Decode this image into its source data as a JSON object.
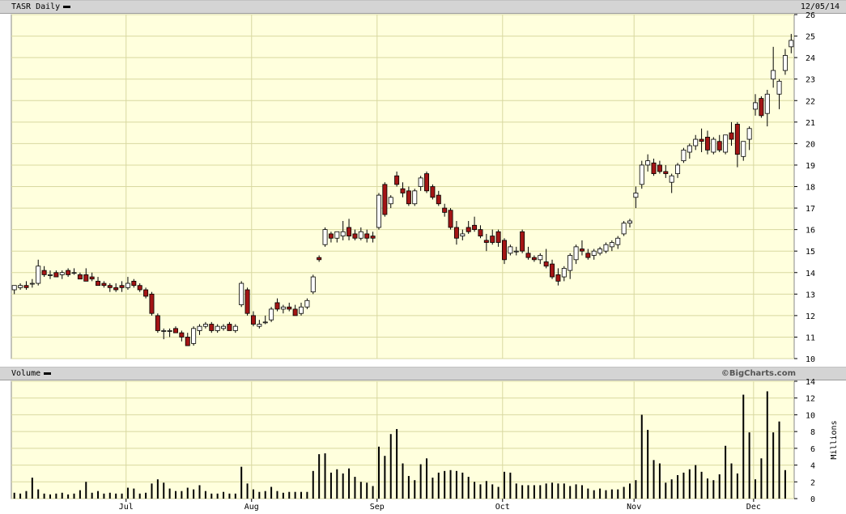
{
  "price_header": {
    "label": "TASR Daily",
    "date": "12/05/14"
  },
  "volume_header": {
    "label": "Volume",
    "brand": "©BigCharts.com"
  },
  "colors": {
    "background": "#ffffdd",
    "grid": "#d8d8a0",
    "up": "#ffffff",
    "down": "#a31515",
    "outline": "#000000"
  },
  "chart_data": [
    {
      "type": "candlestick",
      "title": "TASR Daily",
      "ylim": [
        10,
        26
      ],
      "yticks": [
        10,
        11,
        12,
        13,
        14,
        15,
        16,
        17,
        18,
        19,
        20,
        21,
        22,
        23,
        24,
        25,
        26
      ],
      "x_tick_labels": [
        "Jul",
        "Aug",
        "Sep",
        "Oct",
        "Nov",
        "Dec"
      ],
      "month_start_index": [
        19,
        40,
        61,
        82,
        104,
        124
      ],
      "grid": true,
      "ohlc": [
        [
          13.2,
          13.4,
          13.0,
          13.4
        ],
        [
          13.3,
          13.5,
          13.2,
          13.4
        ],
        [
          13.4,
          13.6,
          13.2,
          13.3
        ],
        [
          13.5,
          13.7,
          13.3,
          13.5
        ],
        [
          13.5,
          14.6,
          13.4,
          14.3
        ],
        [
          14.1,
          14.3,
          13.8,
          13.9
        ],
        [
          13.9,
          14.1,
          13.7,
          13.9
        ],
        [
          14.0,
          14.1,
          13.8,
          13.8
        ],
        [
          13.9,
          14.1,
          13.7,
          14.0
        ],
        [
          14.1,
          14.2,
          13.8,
          13.9
        ],
        [
          14.0,
          14.2,
          13.9,
          14.0
        ],
        [
          13.9,
          14.0,
          13.7,
          13.7
        ],
        [
          13.9,
          14.2,
          13.6,
          13.6
        ],
        [
          13.8,
          14.0,
          13.6,
          13.7
        ],
        [
          13.6,
          13.8,
          13.4,
          13.4
        ],
        [
          13.5,
          13.6,
          13.3,
          13.4
        ],
        [
          13.4,
          13.5,
          13.1,
          13.3
        ],
        [
          13.3,
          13.5,
          13.1,
          13.2
        ],
        [
          13.4,
          13.6,
          13.1,
          13.3
        ],
        [
          13.3,
          13.8,
          13.2,
          13.5
        ],
        [
          13.6,
          13.7,
          13.3,
          13.4
        ],
        [
          13.4,
          13.5,
          13.1,
          13.2
        ],
        [
          13.2,
          13.3,
          12.8,
          12.9
        ],
        [
          13.0,
          13.1,
          12.0,
          12.1
        ],
        [
          12.0,
          12.1,
          11.2,
          11.3
        ],
        [
          11.3,
          11.4,
          10.9,
          11.3
        ],
        [
          11.3,
          11.4,
          11.0,
          11.3
        ],
        [
          11.4,
          11.5,
          11.2,
          11.2
        ],
        [
          11.2,
          11.3,
          10.8,
          11.0
        ],
        [
          11.0,
          11.2,
          10.6,
          10.6
        ],
        [
          10.7,
          11.5,
          10.6,
          11.4
        ],
        [
          11.3,
          11.6,
          11.1,
          11.5
        ],
        [
          11.5,
          11.7,
          11.4,
          11.6
        ],
        [
          11.6,
          11.7,
          11.2,
          11.3
        ],
        [
          11.3,
          11.6,
          11.2,
          11.5
        ],
        [
          11.4,
          11.6,
          11.3,
          11.5
        ],
        [
          11.6,
          11.7,
          11.3,
          11.3
        ],
        [
          11.3,
          11.6,
          11.2,
          11.5
        ],
        [
          12.5,
          13.6,
          12.4,
          13.5
        ],
        [
          13.2,
          13.3,
          12.0,
          12.1
        ],
        [
          12.0,
          12.2,
          11.5,
          11.6
        ],
        [
          11.5,
          11.8,
          11.4,
          11.6
        ],
        [
          11.7,
          12.0,
          11.6,
          11.7
        ],
        [
          11.8,
          12.4,
          11.7,
          12.3
        ],
        [
          12.6,
          12.8,
          12.2,
          12.3
        ],
        [
          12.3,
          12.5,
          12.1,
          12.4
        ],
        [
          12.4,
          12.6,
          12.2,
          12.3
        ],
        [
          12.3,
          12.5,
          12.0,
          12.0
        ],
        [
          12.1,
          12.6,
          12.0,
          12.4
        ],
        [
          12.4,
          12.8,
          12.3,
          12.7
        ],
        [
          13.1,
          13.9,
          13.0,
          13.8
        ],
        [
          14.7,
          14.8,
          14.5,
          14.6
        ],
        [
          15.3,
          16.1,
          15.2,
          16.0
        ],
        [
          15.8,
          15.9,
          15.4,
          15.6
        ],
        [
          15.6,
          15.9,
          15.4,
          15.9
        ],
        [
          15.7,
          16.4,
          15.5,
          15.9
        ],
        [
          16.1,
          16.5,
          15.5,
          15.7
        ],
        [
          15.8,
          16.0,
          15.5,
          15.6
        ],
        [
          15.6,
          16.1,
          15.5,
          15.9
        ],
        [
          15.8,
          16.0,
          15.4,
          15.6
        ],
        [
          15.7,
          15.9,
          15.4,
          15.6
        ],
        [
          16.1,
          17.7,
          16.0,
          17.6
        ],
        [
          18.1,
          18.2,
          16.6,
          16.7
        ],
        [
          17.2,
          17.6,
          17.0,
          17.5
        ],
        [
          18.5,
          18.7,
          18.0,
          18.1
        ],
        [
          17.9,
          18.2,
          17.5,
          17.7
        ],
        [
          17.8,
          18.0,
          17.1,
          17.2
        ],
        [
          17.2,
          17.9,
          17.1,
          17.8
        ],
        [
          18.0,
          18.5,
          17.8,
          18.4
        ],
        [
          18.6,
          18.7,
          17.7,
          17.8
        ],
        [
          18.0,
          18.1,
          17.4,
          17.5
        ],
        [
          17.6,
          17.8,
          17.1,
          17.2
        ],
        [
          17.0,
          17.2,
          16.6,
          16.8
        ],
        [
          16.9,
          17.0,
          16.0,
          16.1
        ],
        [
          16.1,
          16.4,
          15.3,
          15.6
        ],
        [
          15.7,
          16.0,
          15.5,
          15.8
        ],
        [
          16.1,
          16.4,
          15.8,
          15.9
        ],
        [
          16.2,
          16.6,
          15.9,
          16.0
        ],
        [
          16.0,
          16.2,
          15.6,
          15.7
        ],
        [
          15.5,
          15.8,
          15.0,
          15.4
        ],
        [
          15.7,
          16.0,
          15.3,
          15.4
        ],
        [
          15.9,
          16.0,
          15.2,
          15.4
        ],
        [
          15.5,
          15.6,
          14.4,
          14.6
        ],
        [
          14.9,
          15.3,
          14.8,
          15.2
        ],
        [
          15.0,
          15.2,
          14.8,
          15.0
        ],
        [
          15.9,
          16.0,
          14.9,
          15.0
        ],
        [
          14.9,
          15.2,
          14.6,
          14.7
        ],
        [
          14.7,
          14.8,
          14.5,
          14.6
        ],
        [
          14.6,
          14.9,
          14.4,
          14.8
        ],
        [
          14.5,
          15.1,
          14.2,
          14.3
        ],
        [
          14.4,
          14.6,
          13.7,
          13.8
        ],
        [
          13.9,
          14.2,
          13.4,
          13.6
        ],
        [
          13.8,
          14.3,
          13.6,
          14.2
        ],
        [
          14.1,
          14.9,
          13.7,
          14.8
        ],
        [
          14.6,
          15.3,
          14.4,
          15.2
        ],
        [
          15.1,
          15.5,
          14.8,
          15.0
        ],
        [
          14.9,
          15.1,
          14.6,
          14.7
        ],
        [
          14.8,
          15.1,
          14.6,
          15.0
        ],
        [
          14.9,
          15.2,
          14.8,
          15.1
        ],
        [
          15.0,
          15.4,
          14.9,
          15.3
        ],
        [
          15.2,
          15.5,
          15.0,
          15.4
        ],
        [
          15.3,
          15.7,
          15.1,
          15.6
        ],
        [
          15.8,
          16.4,
          15.7,
          16.3
        ],
        [
          16.3,
          16.5,
          16.1,
          16.4
        ],
        [
          17.5,
          18.0,
          17.0,
          17.7
        ],
        [
          18.1,
          19.2,
          17.9,
          19.0
        ],
        [
          19.0,
          19.5,
          18.7,
          19.2
        ],
        [
          19.1,
          19.3,
          18.5,
          18.6
        ],
        [
          19.0,
          19.2,
          18.6,
          18.7
        ],
        [
          18.7,
          19.0,
          18.4,
          18.6
        ],
        [
          18.2,
          18.6,
          17.7,
          18.5
        ],
        [
          18.6,
          19.1,
          18.4,
          19.0
        ],
        [
          19.2,
          19.8,
          19.1,
          19.7
        ],
        [
          19.6,
          20.0,
          19.3,
          19.9
        ],
        [
          19.9,
          20.4,
          19.7,
          20.2
        ],
        [
          20.2,
          20.7,
          19.6,
          20.1
        ],
        [
          20.3,
          20.6,
          19.5,
          19.7
        ],
        [
          19.6,
          20.3,
          19.5,
          20.2
        ],
        [
          20.1,
          20.4,
          19.6,
          19.7
        ],
        [
          19.6,
          20.3,
          19.5,
          20.4
        ],
        [
          20.5,
          21.0,
          19.9,
          20.2
        ],
        [
          20.9,
          21.0,
          18.9,
          19.5
        ],
        [
          19.4,
          20.1,
          19.2,
          20.1
        ],
        [
          20.2,
          20.8,
          19.7,
          20.7
        ],
        [
          21.6,
          22.3,
          21.3,
          21.9
        ],
        [
          22.1,
          22.2,
          21.2,
          21.3
        ],
        [
          21.4,
          22.5,
          20.8,
          22.3
        ],
        [
          23.0,
          24.5,
          22.6,
          23.4
        ],
        [
          22.3,
          23.0,
          21.6,
          22.9
        ],
        [
          23.4,
          24.4,
          23.2,
          24.1
        ],
        [
          24.5,
          25.1,
          24.2,
          24.8
        ]
      ]
    },
    {
      "type": "bar",
      "title": "Volume",
      "ylabel": "Millions",
      "ylim": [
        0,
        14
      ],
      "yticks": [
        0,
        2,
        4,
        6,
        8,
        10,
        12,
        14
      ],
      "grid": true,
      "values": [
        0.7,
        0.6,
        0.9,
        2.5,
        1.1,
        0.6,
        0.5,
        0.6,
        0.7,
        0.5,
        0.6,
        1.0,
        2.0,
        0.7,
        0.9,
        0.6,
        0.7,
        0.6,
        0.6,
        1.3,
        1.2,
        0.6,
        0.7,
        1.8,
        2.3,
        1.9,
        1.2,
        0.9,
        0.9,
        1.3,
        1.1,
        1.6,
        0.9,
        0.6,
        0.6,
        0.8,
        0.6,
        0.6,
        3.8,
        1.8,
        1.1,
        0.8,
        0.9,
        1.4,
        0.9,
        0.7,
        0.8,
        0.8,
        0.8,
        0.8,
        3.3,
        5.3,
        5.4,
        3.1,
        3.5,
        3.0,
        3.6,
        2.6,
        2.0,
        1.9,
        1.5,
        6.2,
        5.1,
        7.7,
        8.3,
        4.2,
        2.7,
        2.2,
        4.1,
        4.8,
        2.5,
        3.1,
        3.3,
        3.4,
        3.3,
        3.1,
        2.6,
        2.0,
        1.7,
        2.1,
        1.7,
        1.4,
        3.2,
        3.1,
        1.8,
        1.6,
        1.6,
        1.6,
        1.6,
        1.8,
        1.9,
        1.8,
        1.8,
        1.5,
        1.7,
        1.6,
        1.2,
        1.0,
        1.2,
        1.0,
        1.1,
        1.1,
        1.4,
        1.8,
        2.2,
        10.0,
        8.2,
        4.6,
        4.2,
        1.9,
        2.3,
        2.8,
        3.1,
        3.5,
        4.0,
        3.2,
        2.4,
        2.2,
        2.9,
        6.3,
        4.2,
        3.0,
        12.4,
        7.9,
        2.3,
        4.8,
        12.8,
        7.9,
        9.2,
        3.4
      ]
    }
  ]
}
